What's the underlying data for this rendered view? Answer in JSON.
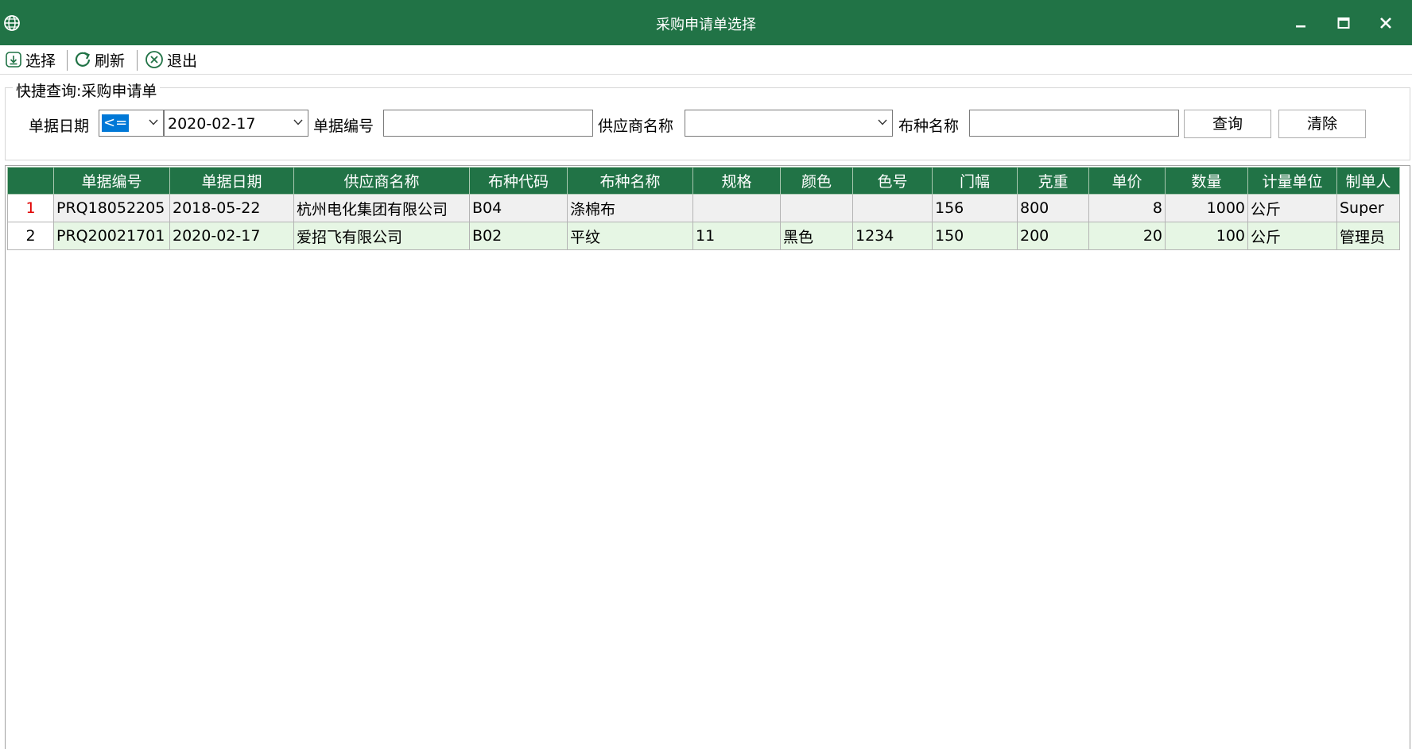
{
  "window": {
    "title": "采购申请单选择"
  },
  "toolbar": {
    "select_label": "选择",
    "refresh_label": "刷新",
    "exit_label": "退出"
  },
  "query": {
    "group_title": "快捷查询:采购申请单",
    "date_label": "单据日期",
    "date_operator": "<=",
    "date_value": "2020-02-17",
    "doc_no_label": "单据编号",
    "doc_no_value": "",
    "supplier_label": "供应商名称",
    "supplier_value": "",
    "fabric_label": "布种名称",
    "fabric_value": "",
    "search_label": "查询",
    "clear_label": "清除"
  },
  "grid": {
    "columns": [
      "单据编号",
      "单据日期",
      "供应商名称",
      "布种代码",
      "布种名称",
      "规格",
      "颜色",
      "色号",
      "门幅",
      "克重",
      "单价",
      "数量",
      "计量单位",
      "制单人"
    ],
    "rows": [
      {
        "rownum": "1",
        "doc_no": "PRQ18052205",
        "date": "2018-05-22",
        "supplier": "杭州电化集团有限公司",
        "fabric_code": "B04",
        "fabric_name": "涤棉布",
        "spec": "",
        "color": "",
        "color_no": "",
        "width": "156",
        "weight": "800",
        "price": "8",
        "qty": "1000",
        "unit": "公斤",
        "creator": "Super"
      },
      {
        "rownum": "2",
        "doc_no": "PRQ20021701",
        "date": "2020-02-17",
        "supplier": "爱招飞有限公司",
        "fabric_code": "B02",
        "fabric_name": "平纹",
        "spec": "11",
        "color": "黑色",
        "color_no": "1234",
        "width": "150",
        "weight": "200",
        "price": "20",
        "qty": "100",
        "unit": "公斤",
        "creator": "管理员"
      }
    ]
  },
  "colors": {
    "accent": "#217346",
    "row_alt": "#e6f6e4",
    "row_current": "#f0f0f0",
    "current_row_number": "#e00000"
  }
}
